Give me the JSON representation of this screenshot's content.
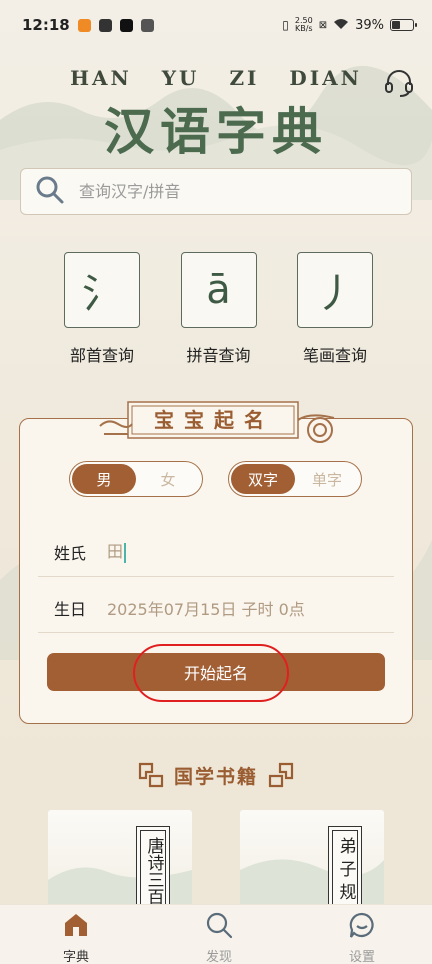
{
  "status_bar": {
    "time": "12:18",
    "network_speed_value": "2.50",
    "network_speed_unit": "KB/s",
    "battery": "39%"
  },
  "header": {
    "pinyin": "HAN YU ZI DIAN",
    "title": "汉语字典",
    "support_icon": "headset-icon"
  },
  "search": {
    "placeholder": "查询汉字/拼音",
    "icon": "search-icon"
  },
  "quick_queries": [
    {
      "glyph": "氵",
      "label": "部首查询"
    },
    {
      "glyph": "ā",
      "label": "拼音查询"
    },
    {
      "glyph": "丿",
      "label": "笔画查询"
    }
  ],
  "baby_naming": {
    "title": "宝宝起名",
    "gender_options": [
      "男",
      "女"
    ],
    "gender_selected": "男",
    "char_options": [
      "双字",
      "单字"
    ],
    "char_selected": "双字",
    "surname_label": "姓氏",
    "surname_value": "田",
    "birth_label": "生日",
    "birth_value": "2025年07月15日 子时 0点",
    "start_button": "开始起名"
  },
  "guoxue": {
    "title": "国学书籍",
    "books": [
      {
        "title": "唐诗三百"
      },
      {
        "title": "弟子规"
      }
    ]
  },
  "bottom_nav": [
    {
      "label": "字典",
      "icon": "home-icon",
      "active": true
    },
    {
      "label": "发现",
      "icon": "search-icon",
      "active": false
    },
    {
      "label": "设置",
      "icon": "chat-bubble-icon",
      "active": false
    }
  ],
  "colors": {
    "accent": "#a25f34",
    "title_green": "#4b6a4e",
    "highlight_ring": "#e02020"
  }
}
